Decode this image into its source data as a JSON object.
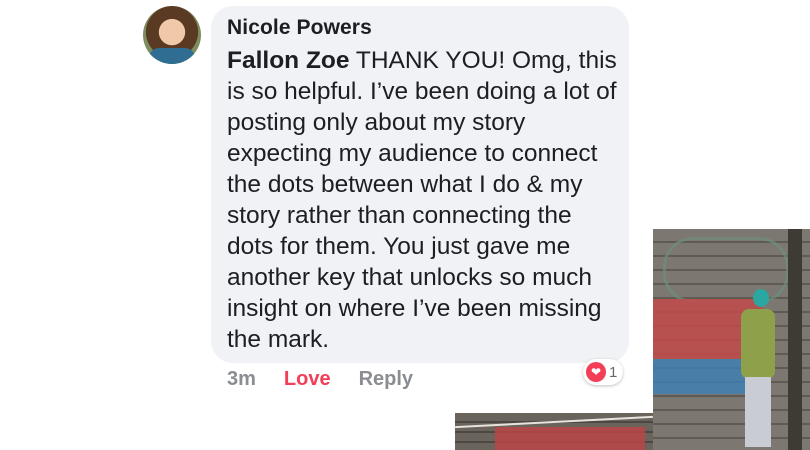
{
  "comment": {
    "author": "Nicole Powers",
    "mention": "Fallon Zoe",
    "text": " THANK YOU!  Omg, this is so helpful. I’ve been doing a lot of posting only about my story expecting my audience to connect the dots between what I do & my story rather than connecting the dots for them. You just gave me another key that unlocks so much insight on where I’ve been missing the mark.",
    "reaction_icon": "heart-icon",
    "reaction_count": "1"
  },
  "actions": {
    "time": "3m",
    "love_label": "Love",
    "reply_label": "Reply"
  },
  "colors": {
    "bubble": "#f0f2f5",
    "love": "#f33e58",
    "muted": "#8a8d91"
  }
}
